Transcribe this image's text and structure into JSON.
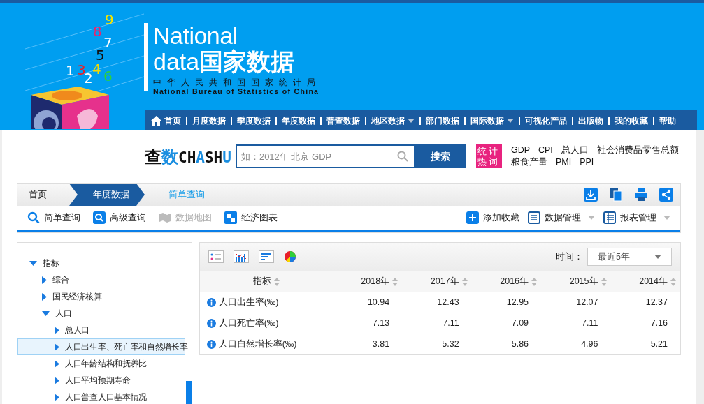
{
  "header": {
    "logo_digits": [
      {
        "text": "9",
        "color": "#f5e400"
      },
      {
        "text": "8",
        "color": "#e8246e"
      },
      {
        "text": "7",
        "color": "#ffffff"
      },
      {
        "text": "5",
        "color": "#111111"
      },
      {
        "text": "1",
        "color": "#ffffff"
      },
      {
        "text": "3",
        "color": "#e8202a"
      },
      {
        "text": "4",
        "color": "#f5d800"
      },
      {
        "text": "2",
        "color": "#ffffff"
      },
      {
        "text": "6",
        "color": "#2fd03a"
      }
    ],
    "title_line1": "National",
    "title_line2_latin": "data",
    "title_line2_cn": "国家数据",
    "org_cn": "中华人民共和国国家统计局",
    "org_en": "National Bureau of Statistics of China"
  },
  "nav": [
    {
      "label": "首页",
      "dropdown": false
    },
    {
      "label": "月度数据",
      "dropdown": false
    },
    {
      "label": "季度数据",
      "dropdown": false
    },
    {
      "label": "年度数据",
      "dropdown": false
    },
    {
      "label": "普查数据",
      "dropdown": false
    },
    {
      "label": "地区数据",
      "dropdown": true
    },
    {
      "label": "部门数据",
      "dropdown": false
    },
    {
      "label": "国际数据",
      "dropdown": true
    },
    {
      "label": "可视化产品",
      "dropdown": false
    },
    {
      "label": "出版物",
      "dropdown": false
    },
    {
      "label": "我的收藏",
      "dropdown": false
    },
    {
      "label": "帮助",
      "dropdown": false
    }
  ],
  "search": {
    "logo": [
      {
        "text": "查",
        "color": "#111111"
      },
      {
        "text": "数",
        "color": "#1a8ee0"
      },
      {
        "text": "CH",
        "color": "#111111"
      },
      {
        "text": "A",
        "color": "#1a8ee0"
      },
      {
        "text": "SH",
        "color": "#111111"
      },
      {
        "text": "U",
        "color": "#1a8ee0"
      }
    ],
    "placeholder": "如：2012年 北京 GDP",
    "button": "搜索",
    "hot_badge": [
      "统计",
      "热词"
    ],
    "hot_words": [
      [
        "GDP",
        "CPI",
        "总人口",
        "社会消费品零售总额"
      ],
      [
        "粮食产量",
        "PMI",
        "PPI"
      ]
    ]
  },
  "breadcrumb": [
    {
      "label": "首页",
      "kind": "plain"
    },
    {
      "label": "年度数据",
      "kind": "active"
    },
    {
      "label": "简单查询",
      "kind": "current"
    }
  ],
  "toolbar_left": [
    {
      "label": "简单查询",
      "disabled": false
    },
    {
      "label": "高级查询",
      "disabled": false
    },
    {
      "label": "数据地图",
      "disabled": true
    },
    {
      "label": "经济图表",
      "disabled": false
    }
  ],
  "toolbar_right": [
    {
      "label": "添加收藏",
      "dropdown": false
    },
    {
      "label": "数据管理",
      "dropdown": true
    },
    {
      "label": "报表管理",
      "dropdown": true
    }
  ],
  "tree": [
    {
      "label": "指标",
      "expanded": true,
      "selected": false,
      "children": [
        {
          "label": "综合",
          "expanded": false,
          "selected": false
        },
        {
          "label": "国民经济核算",
          "expanded": false,
          "selected": false
        },
        {
          "label": "人口",
          "expanded": true,
          "selected": false,
          "children": [
            {
              "label": "总人口",
              "expanded": false,
              "selected": false
            },
            {
              "label": "人口出生率、死亡率和自然增长率",
              "expanded": false,
              "selected": true
            },
            {
              "label": "人口年龄结构和抚养比",
              "expanded": false,
              "selected": false
            },
            {
              "label": "人口平均预期寿命",
              "expanded": false,
              "selected": false
            },
            {
              "label": "人口普查人口基本情况",
              "expanded": false,
              "selected": false
            }
          ]
        }
      ]
    }
  ],
  "table": {
    "time_label": "时间：",
    "time_value": "最近5年",
    "columns": [
      "指标",
      "2018年",
      "2017年",
      "2016年",
      "2015年",
      "2014年"
    ],
    "rows": [
      [
        "人口出生率(‰)",
        "10.94",
        "12.43",
        "12.95",
        "12.07",
        "12.37"
      ],
      [
        "人口死亡率(‰)",
        "7.13",
        "7.11",
        "7.09",
        "7.11",
        "7.16"
      ],
      [
        "人口自然增长率(‰)",
        "3.81",
        "5.32",
        "5.86",
        "4.96",
        "5.21"
      ]
    ]
  }
}
